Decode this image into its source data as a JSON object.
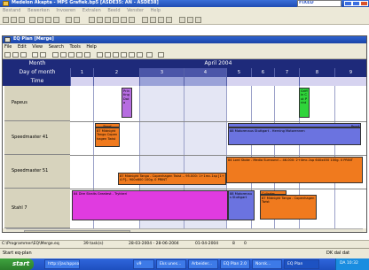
{
  "outer_window": {
    "title": "Medelon Akapta - MPS Grafiek.bp5 [ASDE35: AN - ASDE38]",
    "fixed_label": "FIXED",
    "menu": [
      "Bestand",
      "Bewerken",
      "Invoeren",
      "Extralen",
      "Beeld",
      "Venster",
      "Help"
    ]
  },
  "inner_window": {
    "title": "EQ Plan [Merge]",
    "menu": [
      "File",
      "Edit",
      "View",
      "Search",
      "Tools",
      "Help"
    ]
  },
  "grid": {
    "month_label": "Month",
    "month_value": "April 2004",
    "day_label": "Day of month",
    "time_label": "Time",
    "days": [
      "1",
      "2",
      "3",
      "4",
      "5",
      "6",
      "7",
      "8",
      "9"
    ],
    "rows": [
      {
        "label": "Papeus"
      },
      {
        "label": "Speedmaster 41"
      },
      {
        "label": "Speedmaster 51"
      },
      {
        "label": "Stahl 7"
      }
    ]
  },
  "jobs": [
    {
      "row": "Papeus",
      "color": "purple",
      "text": "Printing Data"
    },
    {
      "row": "Papeus",
      "color": "green",
      "text": "Griffin Cut Print"
    },
    {
      "row": "Speedmaster 41",
      "color": "orange",
      "text": "Proof"
    },
    {
      "row": "Speedmaster 41",
      "color": "orange",
      "text": "87 Midnight Tango Copenhagen Twist"
    },
    {
      "row": "Speedmaster 41",
      "color": "blue",
      "text": "Proof"
    },
    {
      "row": "Speedmaster 41",
      "color": "blue",
      "text": "88 Motorenaus Stuttgart - Herning Motorennen"
    },
    {
      "row": "Speedmaster 51",
      "color": "orange",
      "text": "87 Midnight Tango - Copenhagen Twist -- 95.000: 1+1mc-1sp [1+4 P]-- 900x600 100g. 0 PRINT"
    },
    {
      "row": "Speedmaster 51",
      "color": "orange",
      "text": "84 Lord Stoke - Media Surround -- 46.000: 2+4mc-1sp 640x450 100g. 0 PRINT"
    },
    {
      "row": "Stahl 7",
      "color": "magenta",
      "text": "84 Dire Straits Greatest - Trykkeri"
    },
    {
      "row": "Stahl 7",
      "color": "blue",
      "text": "88 Motorenaus Stuttgart"
    },
    {
      "row": "Stahl 7",
      "color": "orange",
      "text": "Cylinder"
    },
    {
      "row": "Stahl 7",
      "color": "orange",
      "text": "87 Midnight Tango - Copenhagen Twist"
    }
  ],
  "status_bar": {
    "path": "C:\\Programmer\\EQ\\Merge.eq",
    "tasks": "39 task(s)",
    "range": "28-03-2004 - 28-06-2004",
    "current": "01-04-2004",
    "a": "8",
    "b": "0"
  },
  "strip": {
    "left": "Start eq-plan",
    "right": "DK dal dat"
  },
  "taskbar": {
    "start": "start",
    "tasks": [
      "http://jas/appsonline",
      "v9",
      "Eks unes...",
      "Arbeider...",
      "EQ Plan 2.0",
      "Norsk...",
      "EQ Plan"
    ],
    "clock": "DA 10:32"
  }
}
